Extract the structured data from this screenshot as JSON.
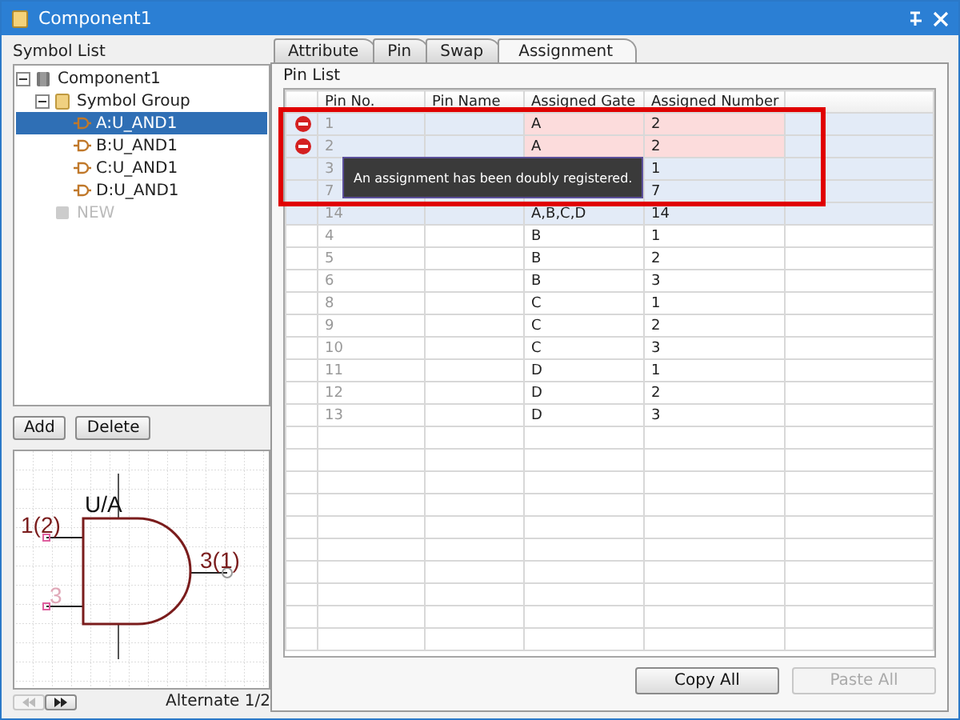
{
  "window": {
    "title": "Component1"
  },
  "symbol_list": {
    "label": "Symbol List",
    "tree": [
      {
        "label": "Component1",
        "kind": "component",
        "expanded": true,
        "selected": false,
        "disabled": false,
        "children": [
          {
            "label": "Symbol Group",
            "kind": "group",
            "expanded": true,
            "selected": false,
            "disabled": false,
            "children": [
              {
                "label": "A:U_AND1",
                "kind": "symbol",
                "selected": true,
                "disabled": false
              },
              {
                "label": "B:U_AND1",
                "kind": "symbol",
                "selected": false,
                "disabled": false
              },
              {
                "label": "C:U_AND1",
                "kind": "symbol",
                "selected": false,
                "disabled": false
              },
              {
                "label": "D:U_AND1",
                "kind": "symbol",
                "selected": false,
                "disabled": false
              }
            ]
          },
          {
            "label": "NEW",
            "kind": "new",
            "selected": false,
            "disabled": true
          }
        ]
      }
    ],
    "buttons": [
      "Add",
      "Delete"
    ]
  },
  "symbol_preview": {
    "gate_label": "U/A",
    "pins": [
      {
        "label": "1(2)",
        "kind": "input",
        "dimmed": false
      },
      {
        "label": "3",
        "kind": "input",
        "dimmed": true
      },
      {
        "label": "3(1)",
        "kind": "output",
        "dimmed": false
      }
    ],
    "previous": {
      "disabled": true
    },
    "next": {
      "disabled": false
    },
    "page": "Alternate 1/2"
  },
  "tabs": [
    {
      "label": "Attribute",
      "selected": false
    },
    {
      "label": "Pin",
      "selected": false
    },
    {
      "label": "Swap",
      "selected": false
    },
    {
      "label": "Assignment",
      "selected": true
    }
  ],
  "pin_list": {
    "label": "Pin List",
    "columns": [
      "Pin No.",
      "Pin Name",
      "Assigned Gate",
      "Assigned Number"
    ],
    "rows": [
      {
        "pin_no": "1",
        "gate": "A",
        "number": "2",
        "error": true,
        "highlighted": true
      },
      {
        "pin_no": "2",
        "gate": "A",
        "number": "2",
        "error": true,
        "highlighted": true
      },
      {
        "pin_no": "3",
        "number": "1",
        "error": false,
        "highlighted": true
      },
      {
        "pin_no": "7",
        "number": "7",
        "error": false,
        "highlighted": true
      },
      {
        "pin_no": "14",
        "gate": "A,B,C,D",
        "number": "14",
        "error": false,
        "highlighted": true
      },
      {
        "pin_no": "4",
        "gate": "B",
        "number": "1",
        "error": false,
        "highlighted": false
      },
      {
        "pin_no": "5",
        "gate": "B",
        "number": "2",
        "error": false,
        "highlighted": false
      },
      {
        "pin_no": "6",
        "gate": "B",
        "number": "3",
        "error": false,
        "highlighted": false
      },
      {
        "pin_no": "8",
        "gate": "C",
        "number": "1",
        "error": false,
        "highlighted": false
      },
      {
        "pin_no": "9",
        "gate": "C",
        "number": "2",
        "error": false,
        "highlighted": false
      },
      {
        "pin_no": "10",
        "gate": "C",
        "number": "3",
        "error": false,
        "highlighted": false
      },
      {
        "pin_no": "11",
        "gate": "D",
        "number": "1",
        "error": false,
        "highlighted": false
      },
      {
        "pin_no": "12",
        "gate": "D",
        "number": "2",
        "error": false,
        "highlighted": false
      },
      {
        "pin_no": "13",
        "gate": "D",
        "number": "3",
        "error": false,
        "highlighted": false
      }
    ],
    "tooltip": "An assignment has been doubly registered."
  },
  "actions": [
    {
      "label": "Copy All",
      "disabled": false
    },
    {
      "label": "Paste All",
      "disabled": true
    }
  ]
}
